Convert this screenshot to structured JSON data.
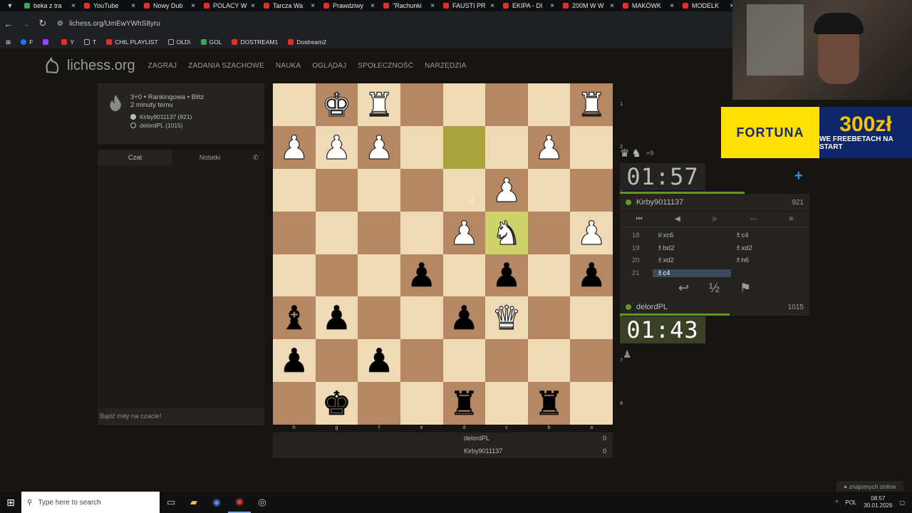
{
  "browser": {
    "tabs": [
      {
        "title": "beka z tra",
        "color": "green"
      },
      {
        "title": "YouTube",
        "color": "red"
      },
      {
        "title": "Nowy Dub",
        "color": "red"
      },
      {
        "title": "POLACY W",
        "color": "red"
      },
      {
        "title": "Tarcza Wa",
        "color": "red"
      },
      {
        "title": "Prawdziwy",
        "color": "red"
      },
      {
        "title": "\"Rachunki",
        "color": "red"
      },
      {
        "title": "FAUSTI PR",
        "color": "red"
      },
      {
        "title": "EKIPA - DI",
        "color": "red"
      },
      {
        "title": "200M W W",
        "color": "red"
      },
      {
        "title": "MAKÓWK",
        "color": "red"
      },
      {
        "title": "MODELK",
        "color": "red"
      }
    ],
    "url": "lichess.org/UmEwYWhS8yru",
    "bookmarks": [
      {
        "label": "F",
        "kind": "blue"
      },
      {
        "label": "",
        "kind": "purple"
      },
      {
        "label": "Y",
        "kind": "red"
      },
      {
        "label": "T",
        "kind": "x"
      },
      {
        "label": "CHIL PLAYLIST",
        "kind": "red"
      },
      {
        "label": "OLD\\",
        "kind": "folder"
      },
      {
        "label": "GOL",
        "kind": "green"
      },
      {
        "label": "DOSTREAM1",
        "kind": "red"
      },
      {
        "label": "Dostream2",
        "kind": "red"
      }
    ]
  },
  "site": {
    "logo": "lichess.org",
    "nav": [
      "ZAGRAJ",
      "ZADANIA SZACHOWE",
      "NAUKA",
      "OGLĄDAJ",
      "SPOŁECZNOŚĆ",
      "NARZĘDZIA"
    ]
  },
  "game": {
    "type": "3+0 • Rankingowa • Blitz",
    "when": "2 minuty temu",
    "white": "Kirby9011137 (921)",
    "black": "delordPL (1015)"
  },
  "chat": {
    "tab_chat": "Czat",
    "tab_notes": "Notatki",
    "placeholder": "Bądź miły na czacie!"
  },
  "board": {
    "ranks": [
      "1",
      "2",
      "3",
      "4",
      "5",
      "6",
      "7",
      "8"
    ],
    "files": [
      "h",
      "g",
      "f",
      "e",
      "d",
      "c",
      "b",
      "a"
    ],
    "rows": [
      [
        "",
        "wK",
        "wR",
        "",
        "",
        "",
        "",
        "wR"
      ],
      [
        "wP",
        "wP",
        "wP",
        "",
        "",
        "",
        "wP",
        ""
      ],
      [
        "",
        "",
        "",
        "",
        "",
        "wP",
        "",
        ""
      ],
      [
        "",
        "",
        "",
        "",
        "wP",
        "wN",
        "",
        "wP"
      ],
      [
        "",
        "",
        "",
        "bP",
        "",
        "bP",
        "",
        "bP"
      ],
      [
        "bB",
        "bP",
        "",
        "",
        "bP",
        "wQ",
        "",
        ""
      ],
      [
        "bP",
        "",
        "bP",
        "",
        "",
        "",
        "",
        ""
      ],
      [
        "",
        "bK",
        "",
        "",
        "bR",
        "",
        "bR",
        ""
      ]
    ],
    "last_move_from": [
      1,
      4
    ],
    "last_move_to": [
      3,
      5
    ]
  },
  "crosstable": {
    "rows": [
      {
        "name": "delordPL",
        "score": "0"
      },
      {
        "name": "Kirby9011137",
        "score": "0"
      }
    ]
  },
  "material": {
    "diff": "+9"
  },
  "top": {
    "clock": "01:57",
    "name": "Kirby9011137",
    "rating": "921"
  },
  "bottom": {
    "clock": "01:43",
    "name": "delordPL",
    "rating": "1015"
  },
  "moves": [
    {
      "no": "18",
      "white": "♕xc6",
      "black": "♗c4"
    },
    {
      "no": "19",
      "white": "♗bd2",
      "black": "♗xd2"
    },
    {
      "no": "20",
      "white": "♗xd2",
      "black": "♗h6"
    },
    {
      "no": "21",
      "white": "♗c4",
      "black": ""
    }
  ],
  "ad": {
    "brand": "FORTUNA",
    "big": "300zł",
    "small": "WE FREEBETACH NA START"
  },
  "footer": {
    "friends": "znajomych online"
  },
  "taskbar": {
    "search": "Type here to search",
    "lang": "POL",
    "time": "08:57",
    "date": "30.01.2026"
  },
  "colors": {
    "light_square": "#f0d9b5",
    "dark_square": "#b58863",
    "accent": "#629924"
  }
}
